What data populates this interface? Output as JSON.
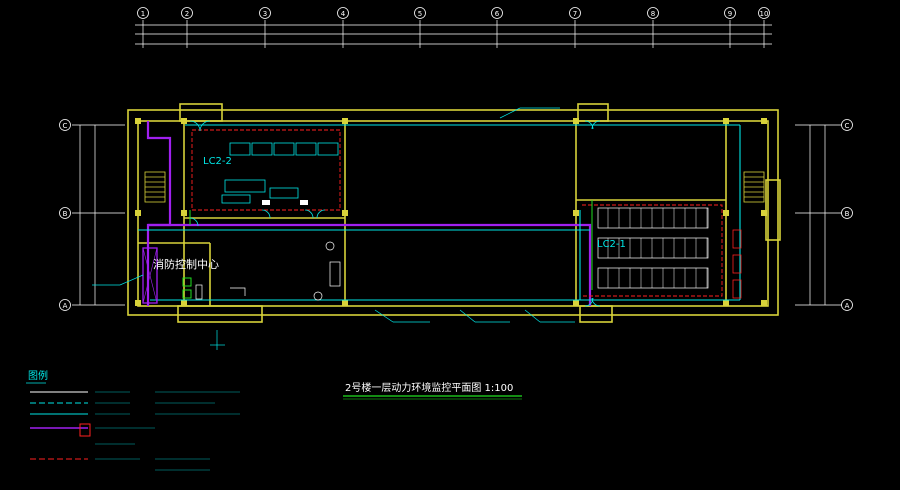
{
  "colors": {
    "background": "#000000",
    "wall": "#d8d23a",
    "grid_line": "#ffffff",
    "cyan": "#00e5e5",
    "magenta": "#a020f0",
    "red": "#ff2020",
    "green": "#20e020",
    "white": "#ffffff"
  },
  "grid_axes": {
    "top": [
      "1",
      "2",
      "3",
      "4",
      "5",
      "6",
      "7",
      "8",
      "9",
      "10"
    ],
    "left": [
      "C",
      "B",
      "A"
    ],
    "right": [
      "C",
      "B",
      "A"
    ]
  },
  "rooms": {
    "fire_control_center": "消防控制中心",
    "lc_2_2": "LC2-2",
    "lc_2_1": "LC2-1"
  },
  "drawing_title": "2号楼一层动力环境监控平面图  1:100",
  "legend": {
    "heading": "图例"
  }
}
